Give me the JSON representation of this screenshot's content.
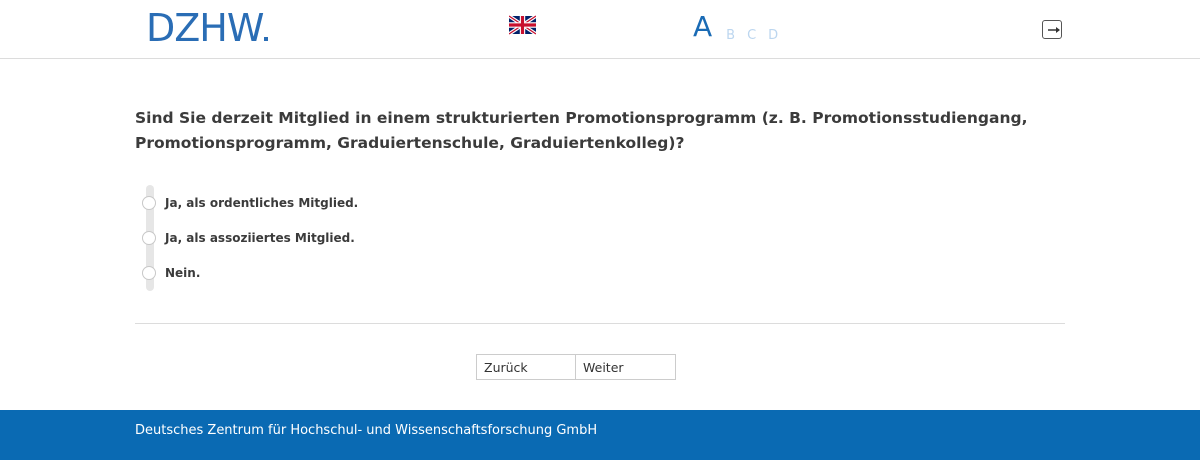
{
  "header": {
    "logo_text": "DZHW",
    "language_flag_icon": "uk-flag-icon",
    "steps": [
      {
        "label": "A",
        "active": true
      },
      {
        "label": "B",
        "active": false
      },
      {
        "label": "C",
        "active": false
      },
      {
        "label": "D",
        "active": false
      }
    ],
    "exit_icon": "exit-icon"
  },
  "question": {
    "text": "Sind Sie derzeit Mitglied in einem strukturierten Promotionsprogramm (z. B. Promotionsstudiengang, Promotionsprogramm, Graduiertenschule, Graduiertenkolleg)?"
  },
  "options": [
    {
      "label": "Ja, als ordentliches Mitglied."
    },
    {
      "label": "Ja, als assoziiertes Mitglied."
    },
    {
      "label": "Nein."
    }
  ],
  "nav": {
    "back_label": "Zurück",
    "next_label": "Weiter"
  },
  "footer": {
    "text": "Deutsches Zentrum für Hochschul- und Wissenschaftsforschung GmbH"
  },
  "colors": {
    "brand_blue": "#0a6ab3",
    "step_active": "#1a6bb5",
    "step_inactive": "#bcd6ef"
  }
}
